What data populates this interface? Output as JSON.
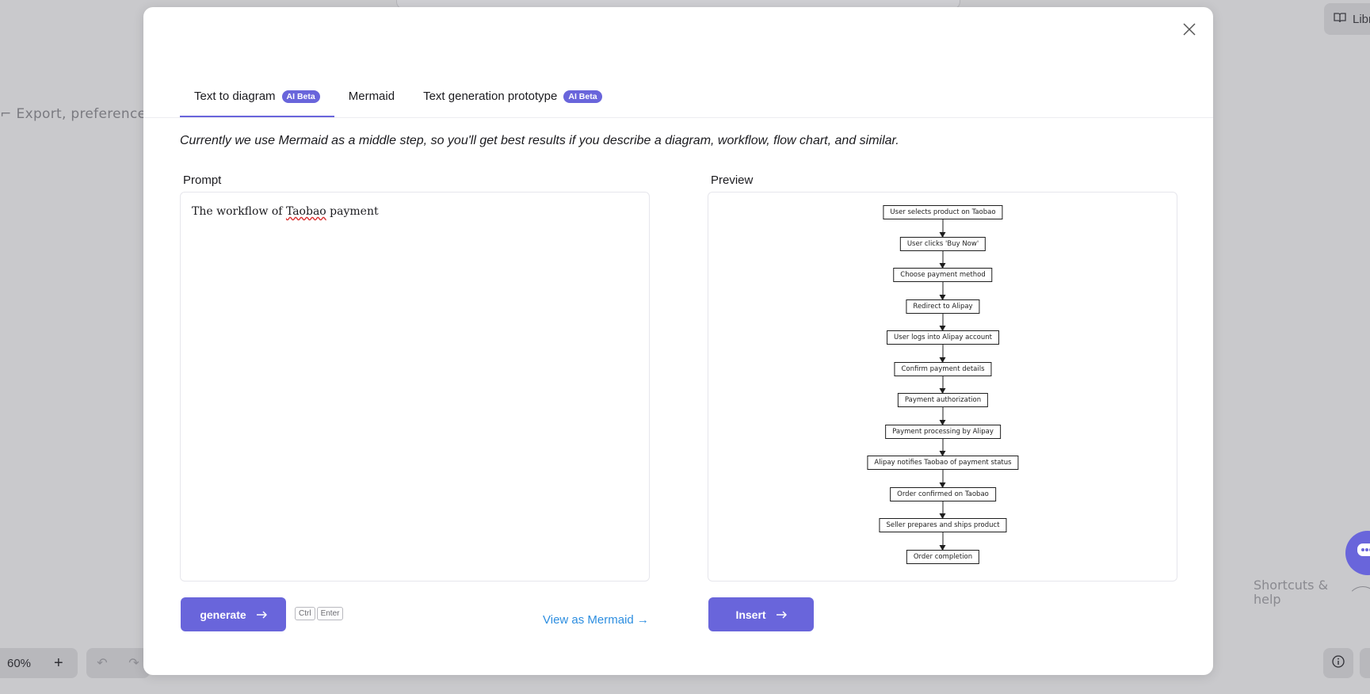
{
  "background": {
    "hint_text": "Export, preference",
    "library_label": "Libr",
    "shortcuts_text": "Shortcuts & help",
    "zoom_value": "60%",
    "zoom_plus": "+"
  },
  "modal": {
    "tabs": [
      {
        "label": "Text to diagram",
        "badge": "AI Beta",
        "active": true
      },
      {
        "label": "Mermaid",
        "badge": "",
        "active": false
      },
      {
        "label": "Text generation prototype",
        "badge": "AI Beta",
        "active": false
      }
    ],
    "description": "Currently we use Mermaid as a middle step, so you'll get best results if you describe a diagram, workflow, flow chart, and similar.",
    "prompt": {
      "label": "Prompt",
      "value_before": "The workflow of ",
      "value_misspelled": "Taobao",
      "value_after": " payment"
    },
    "preview": {
      "label": "Preview",
      "nodes": [
        "User selects product on Taobao",
        "User clicks 'Buy Now'",
        "Choose payment method",
        "Redirect to Alipay",
        "User logs into Alipay account",
        "Confirm payment details",
        "Payment authorization",
        "Payment processing by Alipay",
        "Alipay notifies Taobao of payment status",
        "Order confirmed on Taobao",
        "Seller prepares and ships product",
        "Order completion"
      ]
    },
    "generate_label": "generate",
    "shortcut_keys": [
      "Ctrl",
      "Enter"
    ],
    "mermaid_link": "View as Mermaid →",
    "insert_label": "Insert"
  },
  "colors": {
    "accent": "#6965db",
    "link": "#2d8ee0",
    "overlay": "#c9c9cc"
  },
  "icons": {
    "close": "close-icon",
    "arrow": "arrow-right-icon",
    "library": "book-icon",
    "help": "info-icon",
    "chat": "chat-icon"
  }
}
